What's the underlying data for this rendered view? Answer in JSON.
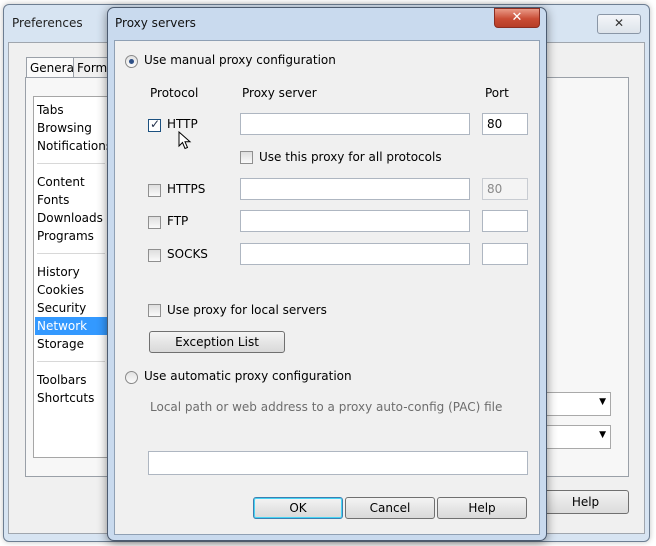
{
  "preferences": {
    "title": "Preferences",
    "tabs": [
      "General",
      "Forms"
    ],
    "categories": [
      [
        "Tabs",
        "Browsing",
        "Notifications"
      ],
      [
        "Content",
        "Fonts",
        "Downloads",
        "Programs"
      ],
      [
        "History",
        "Cookies",
        "Security",
        "Network",
        "Storage"
      ],
      [
        "Toolbars",
        "Shortcuts"
      ]
    ],
    "selected_category": "Network",
    "help_label": "Help"
  },
  "dialog": {
    "title": "Proxy servers",
    "close_glyph": "✕",
    "manual_label": "Use manual proxy configuration",
    "manual_selected": true,
    "headers": {
      "protocol": "Protocol",
      "server": "Proxy server",
      "port": "Port"
    },
    "protocols": [
      {
        "name": "HTTP",
        "checked": true,
        "server": "",
        "port": "80",
        "port_enabled": true
      },
      {
        "name": "HTTPS",
        "checked": false,
        "server": "",
        "port": "80",
        "port_enabled": false
      },
      {
        "name": "FTP",
        "checked": false,
        "server": "",
        "port": "",
        "port_enabled": true
      },
      {
        "name": "SOCKS",
        "checked": false,
        "server": "",
        "port": "",
        "port_enabled": true
      }
    ],
    "all_protocols_label": "Use this proxy for all protocols",
    "local_servers_label": "Use proxy for local servers",
    "exception_button": "Exception List",
    "auto_label": "Use automatic proxy configuration",
    "pac_label": "Local path or web address to a proxy auto-config (PAC) file",
    "pac_value": "",
    "ok_label": "OK",
    "cancel_label": "Cancel",
    "help_label": "Help"
  },
  "icons": {
    "check": "✓",
    "dropdown": "▼",
    "cursor": "mouse-pointer-icon"
  },
  "colors": {
    "selection": "#3399ff",
    "close_button": "#c94c35",
    "dialog_frame": "#c9daee"
  }
}
